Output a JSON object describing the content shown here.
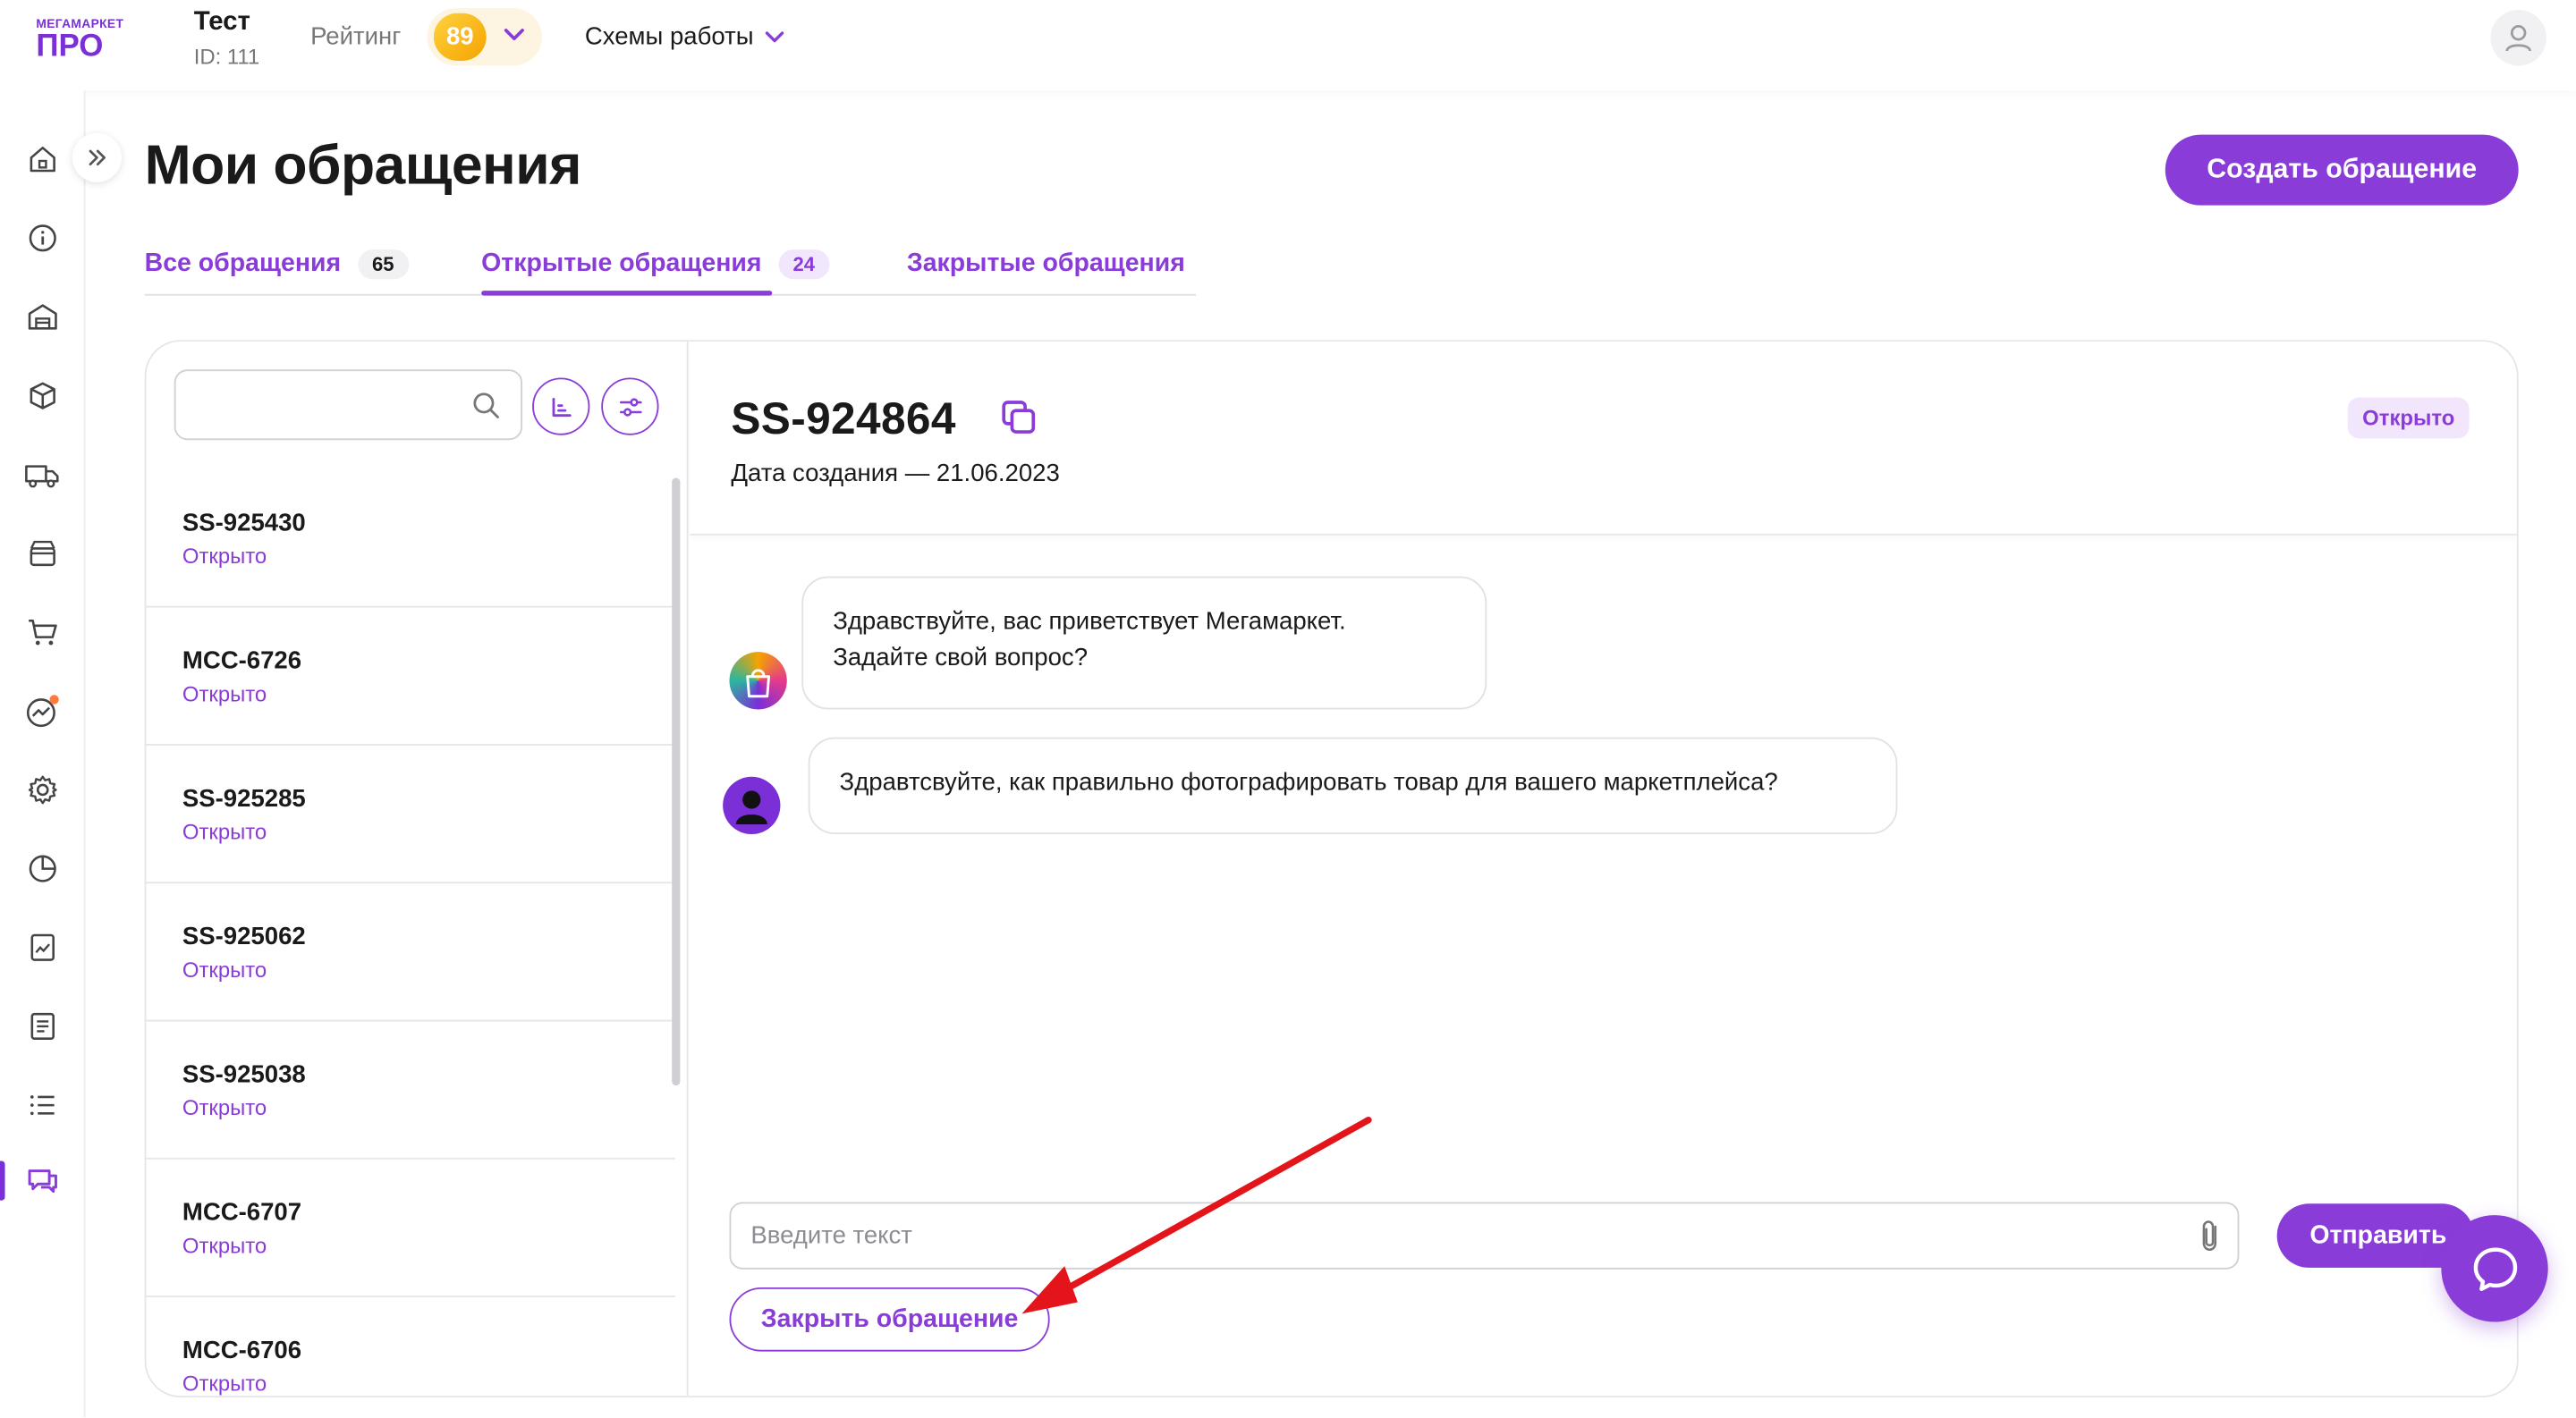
{
  "header": {
    "logo_small": "МЕГАМАРКЕТ",
    "logo_big": "ПРО",
    "user_name": "Тест",
    "user_id": "ID: 111",
    "rating_label": "Рейтинг",
    "rating_value": "89",
    "schemes_label": "Схемы работы"
  },
  "sidebar": {
    "icons": [
      "home-icon",
      "info-icon",
      "warehouse-icon",
      "box-icon",
      "truck-icon",
      "store-icon",
      "cart-icon",
      "analytics-icon",
      "settings-icon",
      "pie-chart-icon",
      "report-icon",
      "document-icon",
      "list-icon",
      "chat-icon"
    ],
    "active": "chat-icon"
  },
  "page": {
    "title": "Мои обращения",
    "create_button": "Создать обращение"
  },
  "tabs": [
    {
      "label": "Все обращения",
      "count": "65"
    },
    {
      "label": "Открытые обращения",
      "count": "24",
      "active": true
    },
    {
      "label": "Закрытые обращения",
      "count": ""
    }
  ],
  "list": {
    "search_placeholder": "",
    "items": [
      {
        "id": "SS-925430",
        "status": "Открыто"
      },
      {
        "id": "MCC-6726",
        "status": "Открыто"
      },
      {
        "id": "SS-925285",
        "status": "Открыто"
      },
      {
        "id": "SS-925062",
        "status": "Открыто"
      },
      {
        "id": "SS-925038",
        "status": "Открыто"
      },
      {
        "id": "MCC-6707",
        "status": "Открыто"
      },
      {
        "id": "MCC-6706",
        "status": "Открыто"
      }
    ]
  },
  "chat": {
    "ticket_id": "SS-924864",
    "created": "Дата создания — 21.06.2023",
    "status": "Открыто",
    "messages": [
      {
        "from": "support",
        "line1": "Здравствуйте, вас приветствует Мегамаркет.",
        "line2": "Задайте свой вопрос?"
      },
      {
        "from": "user",
        "text": "Здравтсвуйте, как правильно фотографировать товар для вашего маркетплейса?"
      }
    ],
    "input_placeholder": "Введите текст",
    "send_button": "Отправить",
    "close_button": "Закрыть обращение"
  },
  "colors": {
    "accent": "#8a3cd8",
    "accent_light": "#f1e6fb",
    "rating_gold": "#f5a300",
    "annotation_arrow": "#e3151a"
  }
}
